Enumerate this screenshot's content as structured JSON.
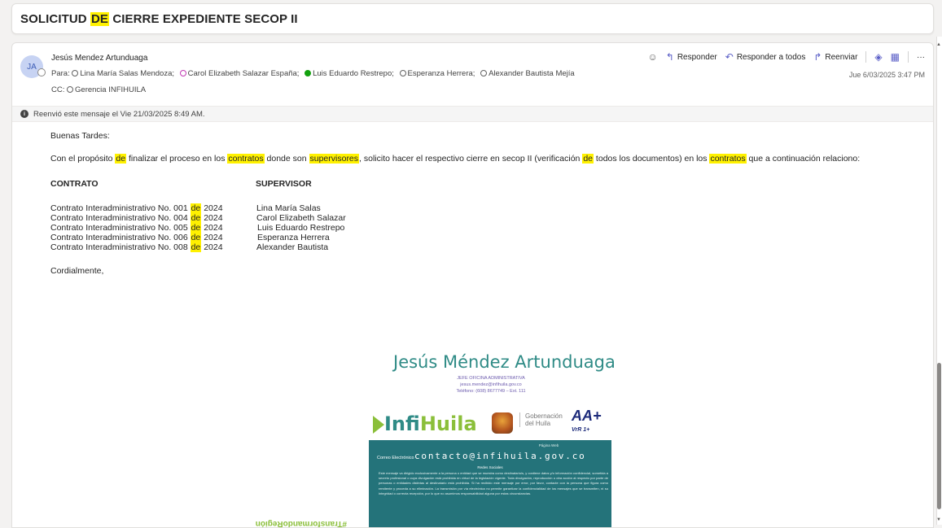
{
  "subject": {
    "before": "SOLICITUD ",
    "highlight": "DE",
    "after": " CIERRE EXPEDIENTE SECOP II"
  },
  "header": {
    "avatar_initials": "JA",
    "sender": "Jesús Mendez Artunduaga",
    "to_label": "Para:",
    "to": [
      {
        "name": "Lina María Salas Mendoza;",
        "status": "grey"
      },
      {
        "name": "Carol Elizabeth Salazar España;",
        "status": "pink"
      },
      {
        "name": "Luis Eduardo Restrepo;",
        "status": "green"
      },
      {
        "name": "Esperanza Herrera;",
        "status": "empty"
      },
      {
        "name": "Alexander Bautista Mejía",
        "status": "grey"
      }
    ],
    "cc_label": "CC:",
    "cc": "Gerencia INFIHUILA",
    "date": "Jue 6/03/2025 3:47 PM"
  },
  "actions": {
    "reply": "Responder",
    "reply_all": "Responder a todos",
    "forward": "Reenviar",
    "more": "···"
  },
  "forward_notice": "Reenvió este mensaje el Vie 21/03/2025 8:49 AM.",
  "body": {
    "greeting": "Buenas Tardes:",
    "intro": {
      "p1": "Con el propósito ",
      "h1": "de",
      "p2": " finalizar el proceso en los ",
      "h2": "contratos",
      "p3": " donde son ",
      "h3": "supervisores",
      "p4": ", solicito hacer el respectivo cierre en secop II (verificación ",
      "h4": "de",
      "p5": " todos los documentos) en los ",
      "h5": "contratos",
      "p6": " que a continuación relaciono:"
    },
    "col_contract": "CONTRATO",
    "col_supervisor": "SUPERVISOR",
    "rows": [
      {
        "pre": "Contrato Interadministrativo No. 001 ",
        "hl": "de",
        "post": " 2024",
        "supervisor": "Lina María Salas"
      },
      {
        "pre": "Contrato Interadministrativo No. 004 ",
        "hl": "de",
        "post": " 2024",
        "supervisor": "Carol Elizabeth Salazar"
      },
      {
        "pre": "Contrato Interadministrativo No. 005 ",
        "hl": "de",
        "post": " 2024",
        "supervisor": "Luis Eduardo Restrepo"
      },
      {
        "pre": "Contrato Interadministrativo No. 006 ",
        "hl": "de",
        "post": " 2024",
        "supervisor": "Esperanza Herrera"
      },
      {
        "pre": "Contrato Interadministrativo No. 008 ",
        "hl": "de",
        "post": " 2024",
        "supervisor": "Alexander Bautista"
      }
    ],
    "closing": "Cordialmente,"
  },
  "signature": {
    "name": "Jesús Méndez Artunduaga",
    "role": "JEFE OFICINA ADMINISTRATIVA",
    "email": "jesus.mendez@infihuila.gov.co",
    "phone": "Teléfono: (608) 8677749 – Ext. 111",
    "brand_a": "Infi",
    "brand_b": "Huila",
    "gob_1": "Gobernación",
    "gob_2": "del Huila",
    "rating": "AA+",
    "rating_sub": "VrR 1+",
    "tag": "#TransformandoRegión",
    "web_label": "Página Web",
    "mail_label": "Correo Electrónico",
    "mail": "contacto@infihuila.gov.co",
    "social_label": "Redes Sociales",
    "legal": "Este mensaje va dirigido exclusivamente a la persona o entidad que se muestra como destinatario/s, y contiene datos y/o información confidencial, sometida a secreto profesional o cuya divulgación está prohibida en virtud de la legislación vigente. Toda divulgación, reproducción u otra acción al respecto por parte de personas o entidades distintas al destinatario está prohibida. Si ha recibido este mensaje por error, por favor, contacte con la persona que figura como remitente y proceda a su eliminación. La transmisión por vía electrónica no permite garantizar la confidencialidad de los mensajes que se transmiten, ni su integridad o correcta recepción, por lo que no asumimos responsabilidad alguna por estas circunstancias."
  },
  "colors": {
    "highlight": "#fff100",
    "accent": "#5b5fc7",
    "teal": "#24737a",
    "green_brand": "#8bbf3a"
  }
}
